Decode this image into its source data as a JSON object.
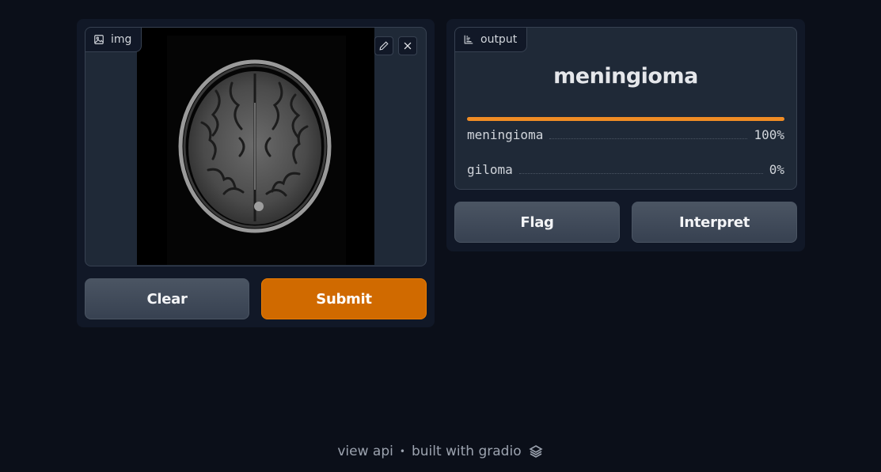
{
  "input": {
    "label": "img",
    "image_alt": "Axial brain MRI scan"
  },
  "buttons": {
    "clear": "Clear",
    "submit": "Submit",
    "flag": "Flag",
    "interpret": "Interpret"
  },
  "output": {
    "label": "output",
    "top_label": "meningioma",
    "confidences": [
      {
        "label": "meningioma",
        "value_text": "100%",
        "value": 1.0
      },
      {
        "label": "giloma",
        "value_text": "0%",
        "value": 0.0
      }
    ]
  },
  "footer": {
    "view_api": "view api",
    "separator": "•",
    "built_with": "built with gradio"
  },
  "colors": {
    "accent": "#d06a00",
    "bar": "#f08c24",
    "background": "#0b0f19",
    "panel": "#111827"
  }
}
